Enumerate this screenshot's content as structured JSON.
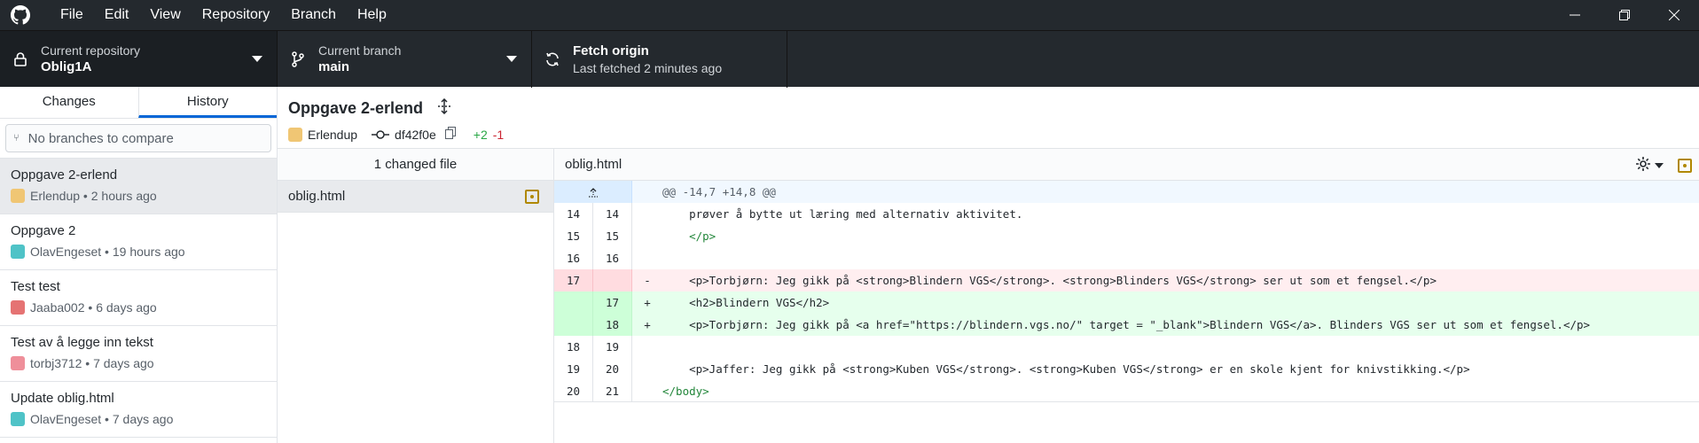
{
  "menubar": {
    "items": [
      "File",
      "Edit",
      "View",
      "Repository",
      "Branch",
      "Help"
    ]
  },
  "toolbar": {
    "repo_label": "Current repository",
    "repo_value": "Oblig1A",
    "branch_label": "Current branch",
    "branch_value": "main",
    "fetch_title": "Fetch origin",
    "fetch_sub": "Last fetched 2 minutes ago"
  },
  "sidebar": {
    "tabs": [
      "Changes",
      "History"
    ],
    "selected_tab": "History",
    "compare_placeholder": "No branches to compare",
    "commits": [
      {
        "title": "Oppgave 2-erlend",
        "author": "Erlendup",
        "time": "2 hours ago",
        "avatar_color": "#f0c674"
      },
      {
        "title": "Oppgave 2",
        "author": "OlavEngeset",
        "time": "19 hours ago",
        "avatar_color": "#4fc3c7"
      },
      {
        "title": "Test test",
        "author": "Jaaba002",
        "time": "6 days ago",
        "avatar_color": "#e57373"
      },
      {
        "title": "Test av å legge inn tekst",
        "author": "torbj3712",
        "time": "7 days ago",
        "avatar_color": "#ef8f9a"
      },
      {
        "title": "Update oblig.html",
        "author": "OlavEngeset",
        "time": "7 days ago",
        "avatar_color": "#4fc3c7"
      }
    ]
  },
  "commit": {
    "title": "Oppgave 2-erlend",
    "author": "Erlendup",
    "sha": "df42f0e",
    "additions": "+2",
    "deletions": "-1"
  },
  "files": {
    "header": "1 changed file",
    "items": [
      "oblig.html"
    ]
  },
  "diff": {
    "filename": "oblig.html",
    "hunk": "@@ -14,7 +14,8 @@",
    "lines": [
      {
        "old": "14",
        "new": "14",
        "sign": "",
        "type": "ctx",
        "text": "    prøver å bytte ut læring med alternativ aktivitet."
      },
      {
        "old": "15",
        "new": "15",
        "sign": "",
        "type": "ctx",
        "text": "    </p>"
      },
      {
        "old": "16",
        "new": "16",
        "sign": "",
        "type": "ctx",
        "text": ""
      },
      {
        "old": "17",
        "new": "",
        "sign": "-",
        "type": "del",
        "text": "    <p>Torbjørn: Jeg gikk på <strong>Blindern VGS</strong>. <strong>Blinders VGS</strong> ser ut som et fengsel.</p>"
      },
      {
        "old": "",
        "new": "17",
        "sign": "+",
        "type": "add",
        "text": "    <h2>Blindern VGS</h2>"
      },
      {
        "old": "",
        "new": "18",
        "sign": "+",
        "type": "add",
        "text": "    <p>Torbjørn: Jeg gikk på <a href=\"https://blindern.vgs.no/\" target = \"_blank\">Blindern VGS</a>. Blinders VGS ser ut som et fengsel.</p>"
      },
      {
        "old": "18",
        "new": "19",
        "sign": "",
        "type": "ctx",
        "text": ""
      },
      {
        "old": "19",
        "new": "20",
        "sign": "",
        "type": "ctx",
        "text": "    <p>Jaffer: Jeg gikk på <strong>Kuben VGS</strong>. <strong>Kuben VGS</strong> er en skole kjent for knivstikking.</p>"
      },
      {
        "old": "20",
        "new": "21",
        "sign": "",
        "type": "ctx",
        "text": "</body>"
      }
    ]
  }
}
